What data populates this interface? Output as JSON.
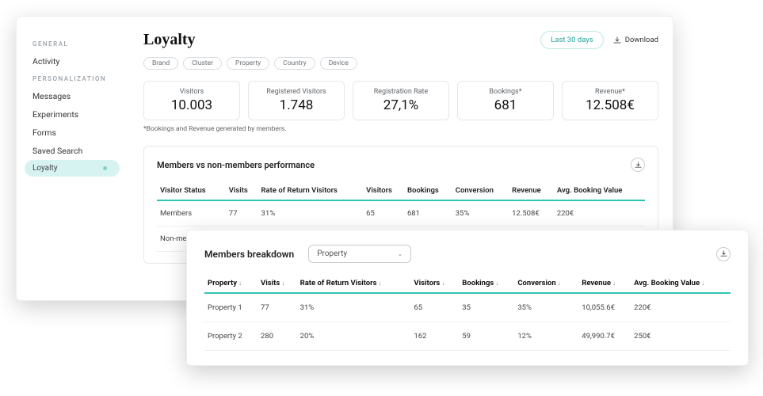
{
  "sidebar": {
    "cat1": "GENERAL",
    "cat2": "PERSONALIZATION",
    "items": {
      "activity": "Activity",
      "messages": "Messages",
      "experiments": "Experiments",
      "forms": "Forms",
      "savedsearch": "Saved Search",
      "loyalty": "Loyalty"
    }
  },
  "header": {
    "title": "Loyalty",
    "daterange": "Last 30 days",
    "download": "Download"
  },
  "filters": [
    "Brand",
    "Cluster",
    "Property",
    "Country",
    "Device"
  ],
  "kpi": [
    {
      "label": "Visitors",
      "value": "10.003"
    },
    {
      "label": "Registered Visitors",
      "value": "1.748"
    },
    {
      "label": "Registration Rate",
      "value": "27,1%"
    },
    {
      "label": "Bookings*",
      "value": "681"
    },
    {
      "label": "Revenue*",
      "value": "12.508€"
    }
  ],
  "footnote": "*Bookings and Revenue generated by members.",
  "perf": {
    "title": "Members vs non-members performance",
    "headers": [
      "Visitor Status",
      "Visits",
      "Rate of Return Visitors",
      "Visitors",
      "Bookings",
      "Conversion",
      "Revenue",
      "Avg. Booking Value"
    ],
    "rows": [
      {
        "status": "Members",
        "visits": "77",
        "rrv": "31%",
        "visitors": "65",
        "bookings": "681",
        "conv": "35%",
        "rev": "12.508€",
        "abv": "220€"
      },
      {
        "status": "Non-members",
        "visits": "",
        "rrv": "",
        "visitors": "",
        "bookings": "",
        "conv": "",
        "rev": "",
        "abv": ""
      }
    ]
  },
  "breakdown": {
    "title": "Members breakdown",
    "select": "Property",
    "headers": [
      "Property",
      "Visits",
      "Rate of Return Visitors",
      "Visitors",
      "Bookings",
      "Conversion",
      "Revenue",
      "Avg. Booking Value"
    ],
    "rows": [
      {
        "prop": "Property 1",
        "visits": "77",
        "rrv": "31%",
        "visitors": "65",
        "bookings": "35",
        "conv": "35%",
        "rev": "10,055.6€",
        "abv": "220€"
      },
      {
        "prop": "Property 2",
        "visits": "280",
        "rrv": "20%",
        "visitors": "162",
        "bookings": "59",
        "conv": "12%",
        "rev": "49,990.7€",
        "abv": "250€"
      }
    ]
  }
}
